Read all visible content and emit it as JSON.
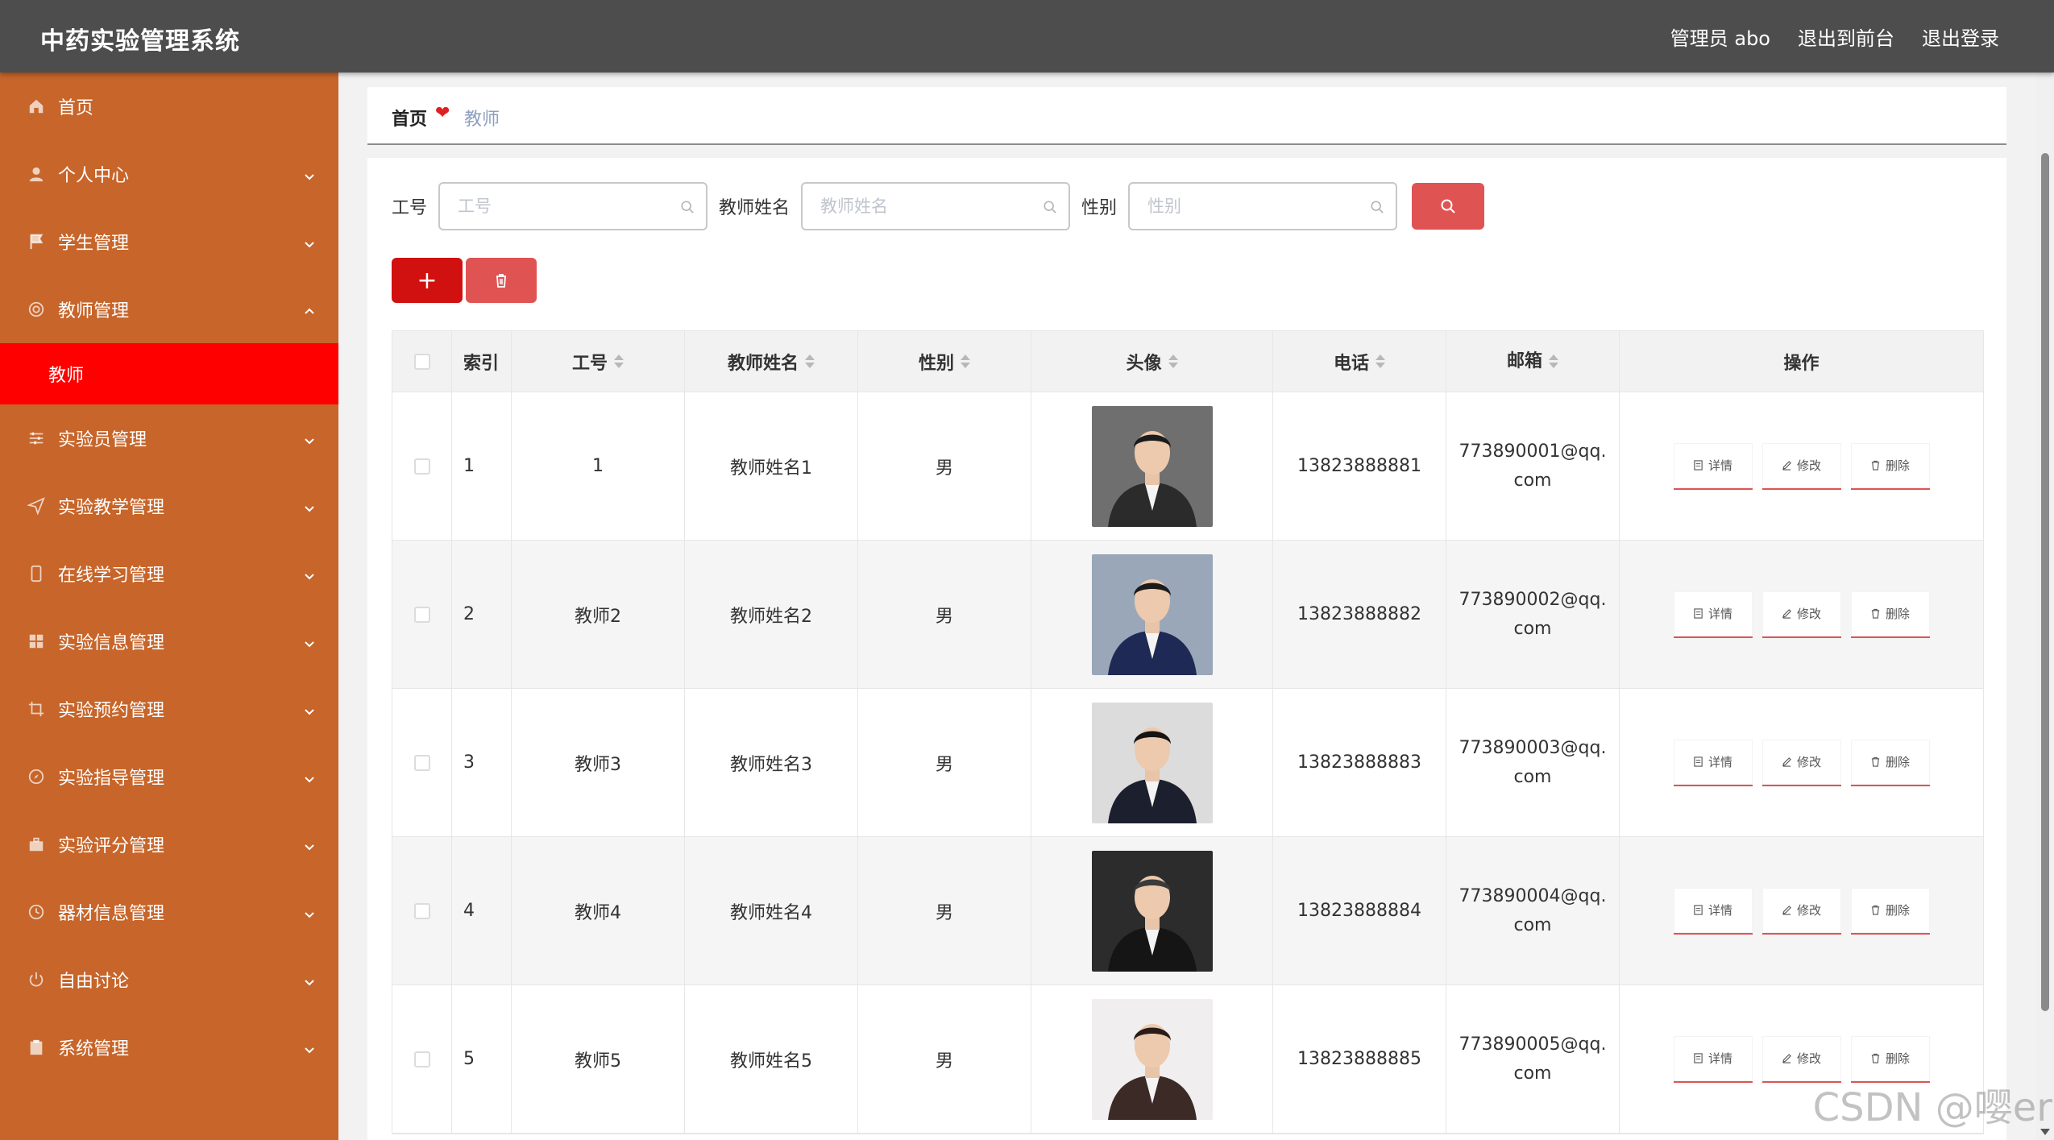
{
  "header": {
    "title": "中药实验管理系统",
    "user": "管理员 abo",
    "to_front": "退出到前台",
    "logout": "退出登录"
  },
  "sidebar": {
    "items": [
      {
        "label": "首页",
        "icon": "home-icon"
      },
      {
        "label": "个人中心",
        "icon": "user-icon"
      },
      {
        "label": "学生管理",
        "icon": "flag-icon"
      },
      {
        "label": "教师管理",
        "icon": "gear-icon"
      },
      {
        "label": "实验员管理",
        "icon": "sliders-icon"
      },
      {
        "label": "实验教学管理",
        "icon": "send-icon"
      },
      {
        "label": "在线学习管理",
        "icon": "mobile-icon"
      },
      {
        "label": "实验信息管理",
        "icon": "grid-icon"
      },
      {
        "label": "实验预约管理",
        "icon": "crop-icon"
      },
      {
        "label": "实验指导管理",
        "icon": "compass-icon"
      },
      {
        "label": "实验评分管理",
        "icon": "briefcase-icon"
      },
      {
        "label": "器材信息管理",
        "icon": "time-icon"
      },
      {
        "label": "自由讨论",
        "icon": "power-icon"
      },
      {
        "label": "系统管理",
        "icon": "clipboard-icon"
      }
    ],
    "active_sub": "教师"
  },
  "breadcrumb": {
    "home": "首页",
    "current": "教师"
  },
  "search": {
    "id_label": "工号",
    "id_placeholder": "工号",
    "name_label": "教师姓名",
    "name_placeholder": "教师姓名",
    "sex_label": "性别",
    "sex_placeholder": "性别"
  },
  "actions": {
    "add": "+"
  },
  "table": {
    "columns": [
      "索引",
      "工号",
      "教师姓名",
      "性别",
      "头像",
      "电话",
      "邮箱",
      "操作"
    ],
    "ops": [
      "详情",
      "修改",
      "删除"
    ],
    "rows": [
      {
        "index": "1",
        "id": "1",
        "name": "教师姓名1",
        "sex": "男",
        "phone": "13823888881",
        "email": "773890001@qq.com"
      },
      {
        "index": "2",
        "id": "教师2",
        "name": "教师姓名2",
        "sex": "男",
        "phone": "13823888882",
        "email": "773890002@qq.com"
      },
      {
        "index": "3",
        "id": "教师3",
        "name": "教师姓名3",
        "sex": "男",
        "phone": "13823888883",
        "email": "773890003@qq.com"
      },
      {
        "index": "4",
        "id": "教师4",
        "name": "教师姓名4",
        "sex": "男",
        "phone": "13823888884",
        "email": "773890004@qq.com"
      },
      {
        "index": "5",
        "id": "教师5",
        "name": "教师姓名5",
        "sex": "男",
        "phone": "13823888885",
        "email": "773890005@qq.com"
      }
    ]
  },
  "colors": {
    "header_bg": "#4d4d4d",
    "sidebar_bg": "#c7652a",
    "active_bg": "#ff0000",
    "accent": "#e05353",
    "add_btn": "#d0110f"
  },
  "watermark": "CSDN @嘤er"
}
